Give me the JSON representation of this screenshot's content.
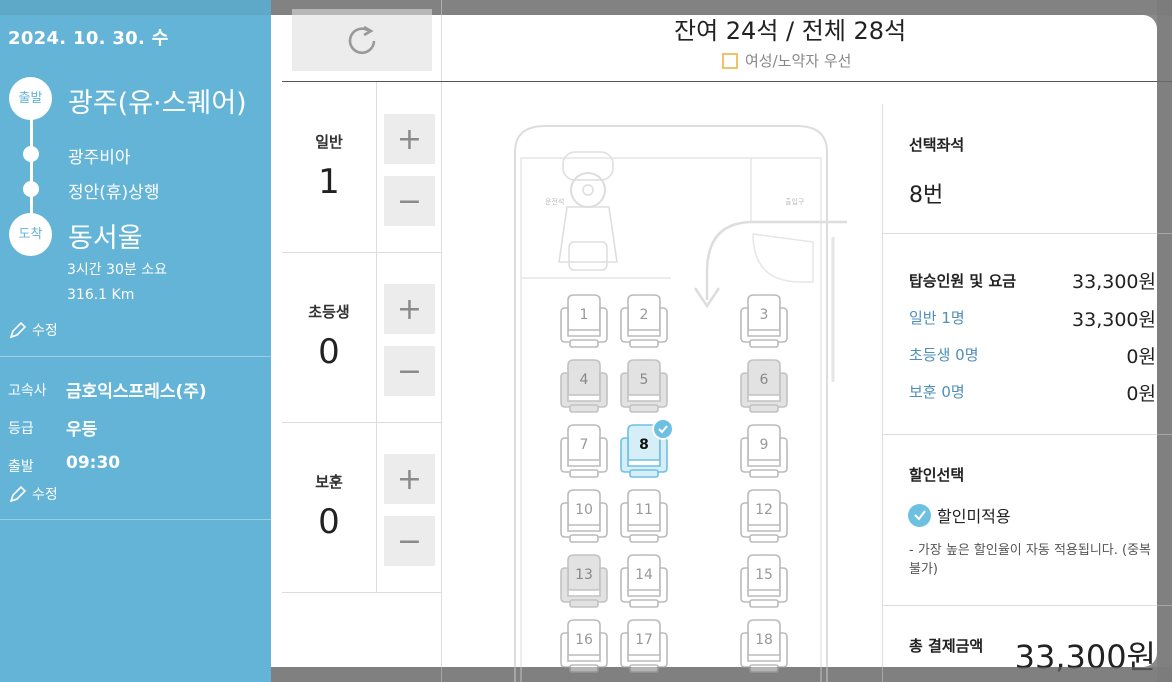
{
  "sidebar": {
    "date": "2024. 10. 30. 수",
    "depart_badge": "출발",
    "depart_station": "광주(유·스퀘어)",
    "stop1": "광주비아",
    "stop2": "정안(휴)상행",
    "arrive_badge": "도착",
    "arrive_station": "동서울",
    "duration": "3시간 30분 소요",
    "distance": "316.1 Km",
    "edit_label": "수정",
    "company_key": "고속사",
    "company_val": "금호익스프레스(주)",
    "grade_key": "등급",
    "grade_val": "우등",
    "time_key": "출발",
    "time_val": "09:30",
    "edit_label2": "수정"
  },
  "header": {
    "seat_count": "잔여 24석 / 전체 28석",
    "priority_label": "여성/노약자 우선"
  },
  "passengers": [
    {
      "label": "일반",
      "count": "1"
    },
    {
      "label": "초등생",
      "count": "0"
    },
    {
      "label": "보훈",
      "count": "0"
    }
  ],
  "bus": {
    "driver_label": "운전석",
    "door_label": "출입구",
    "seats": [
      {
        "num": "1",
        "state": "available"
      },
      {
        "num": "2",
        "state": "available"
      },
      {
        "num": "3",
        "state": "available"
      },
      {
        "num": "4",
        "state": "sold"
      },
      {
        "num": "5",
        "state": "sold"
      },
      {
        "num": "6",
        "state": "sold"
      },
      {
        "num": "7",
        "state": "available"
      },
      {
        "num": "8",
        "state": "selected"
      },
      {
        "num": "9",
        "state": "available"
      },
      {
        "num": "10",
        "state": "available"
      },
      {
        "num": "11",
        "state": "available"
      },
      {
        "num": "12",
        "state": "available"
      },
      {
        "num": "13",
        "state": "sold"
      },
      {
        "num": "14",
        "state": "available"
      },
      {
        "num": "15",
        "state": "available"
      },
      {
        "num": "16",
        "state": "available"
      },
      {
        "num": "17",
        "state": "available"
      },
      {
        "num": "18",
        "state": "available"
      }
    ]
  },
  "summary": {
    "selected_seat_label": "선택좌석",
    "selected_seat_val": "8번",
    "fare_label": "탑승인원 및 요금",
    "fare_total": "33,300원",
    "rows": [
      {
        "label": "일반 1명",
        "val": "33,300원"
      },
      {
        "label": "초등생 0명",
        "val": "0원"
      },
      {
        "label": "보훈 0명",
        "val": "0원"
      }
    ],
    "discount_label": "할인선택",
    "discount_option": "할인미적용",
    "discount_note": "- 가장 높은 할인율이 자동 적용됩니다. (중복불가)",
    "total_label": "총 결제금액",
    "total_val": "33,300원"
  },
  "colors": {
    "sidebar": "#63b4d6",
    "accent": "#6ec0e2",
    "link": "#4f8fb8",
    "priority_box": "#f2c26b"
  }
}
